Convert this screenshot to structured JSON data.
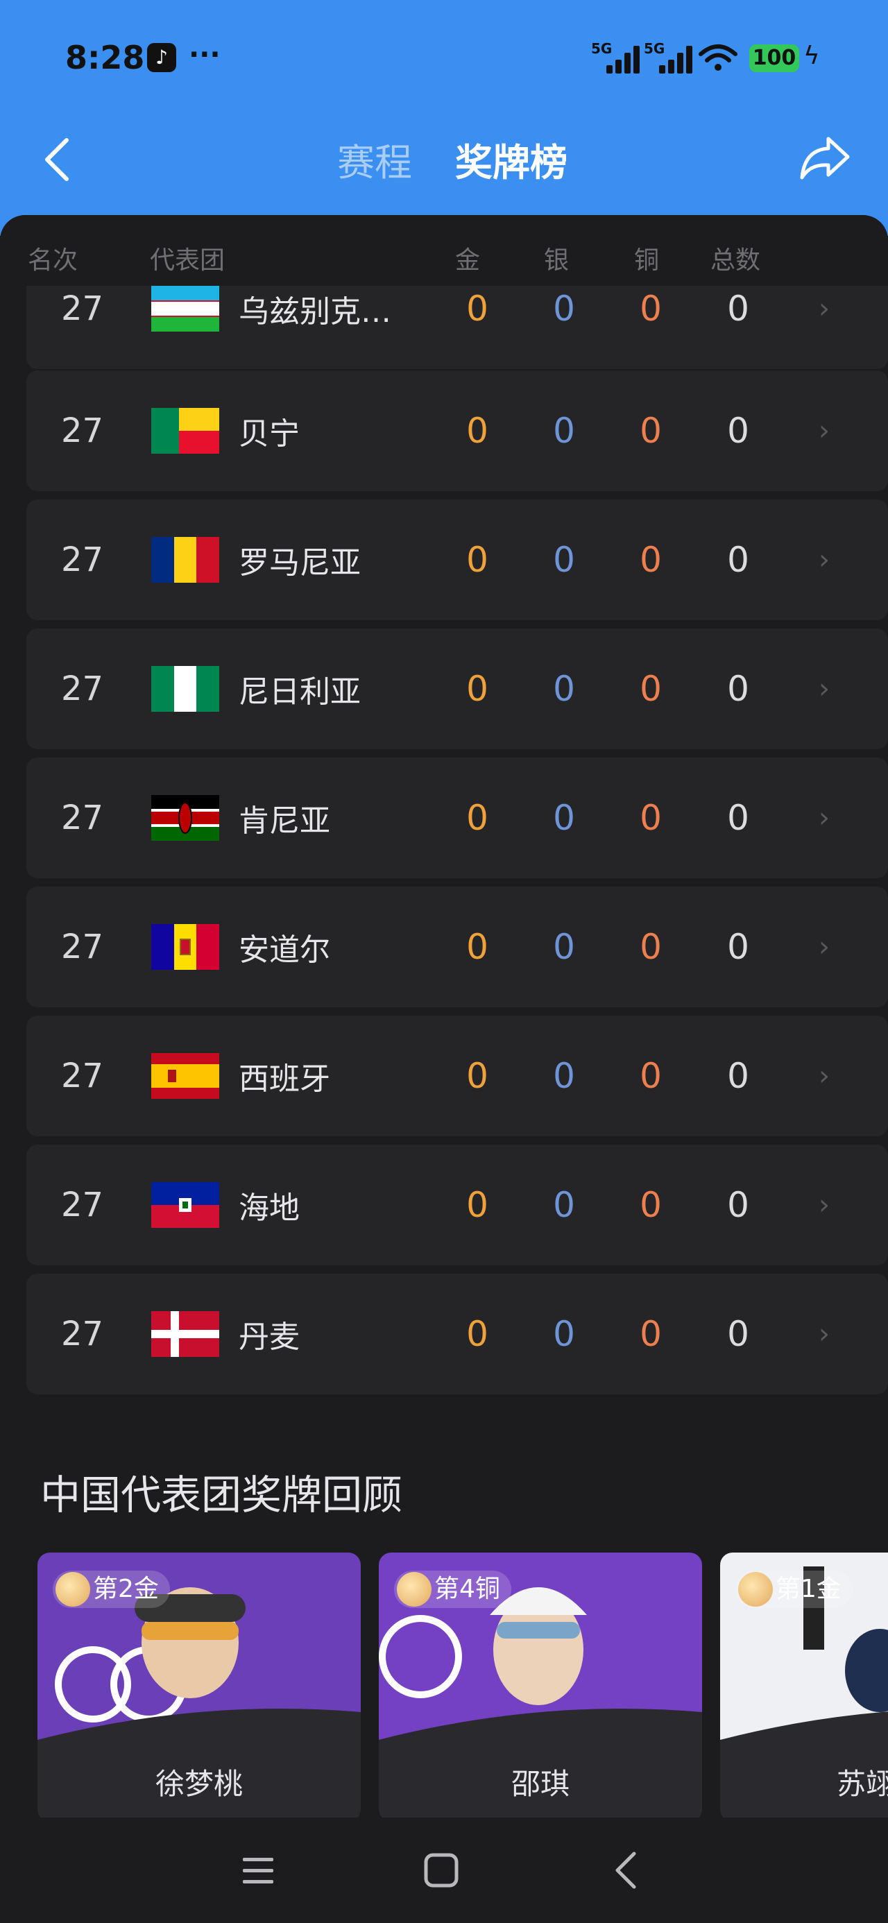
{
  "status": {
    "time": "8:28",
    "more": "···",
    "sig1": "5G",
    "sig2": "5G",
    "battery": "100"
  },
  "header": {
    "tab_schedule": "赛程",
    "tab_medals": "奖牌榜"
  },
  "columns": {
    "rank": "名次",
    "team": "代表团",
    "gold": "金",
    "silver": "银",
    "bronze": "铜",
    "total": "总数"
  },
  "rows": [
    {
      "rank": "27",
      "country": "乌兹别克…",
      "gold": "0",
      "silver": "0",
      "bronze": "0",
      "total": "0",
      "flag": "uzbekistan"
    },
    {
      "rank": "27",
      "country": "贝宁",
      "gold": "0",
      "silver": "0",
      "bronze": "0",
      "total": "0",
      "flag": "benin"
    },
    {
      "rank": "27",
      "country": "罗马尼亚",
      "gold": "0",
      "silver": "0",
      "bronze": "0",
      "total": "0",
      "flag": "romania"
    },
    {
      "rank": "27",
      "country": "尼日利亚",
      "gold": "0",
      "silver": "0",
      "bronze": "0",
      "total": "0",
      "flag": "nigeria"
    },
    {
      "rank": "27",
      "country": "肯尼亚",
      "gold": "0",
      "silver": "0",
      "bronze": "0",
      "total": "0",
      "flag": "kenya"
    },
    {
      "rank": "27",
      "country": "安道尔",
      "gold": "0",
      "silver": "0",
      "bronze": "0",
      "total": "0",
      "flag": "andorra"
    },
    {
      "rank": "27",
      "country": "西班牙",
      "gold": "0",
      "silver": "0",
      "bronze": "0",
      "total": "0",
      "flag": "spain"
    },
    {
      "rank": "27",
      "country": "海地",
      "gold": "0",
      "silver": "0",
      "bronze": "0",
      "total": "0",
      "flag": "haiti"
    },
    {
      "rank": "27",
      "country": "丹麦",
      "gold": "0",
      "silver": "0",
      "bronze": "0",
      "total": "0",
      "flag": "denmark"
    }
  ],
  "section": {
    "title": "中国代表团奖牌回顾"
  },
  "cards": [
    {
      "badge": "第2金",
      "name": "徐梦桃"
    },
    {
      "badge": "第4铜",
      "name": "邵琪"
    },
    {
      "badge": "第1金",
      "name": "苏翊"
    }
  ],
  "colors": {
    "gold": "#f0a23a",
    "silver": "#6f94d8",
    "bronze": "#ee7f4e",
    "header": "#3b8ff0"
  }
}
